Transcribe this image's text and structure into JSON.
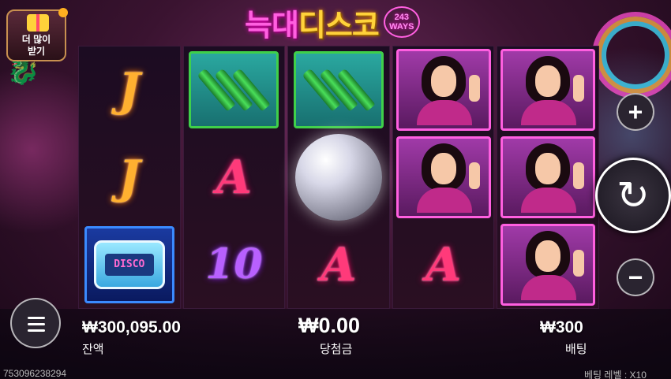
{
  "title": {
    "part1": "늑대",
    "part2": "디스코",
    "ways_number": "243",
    "ways_label": "WAYS"
  },
  "get_more": {
    "line1": "더 많이",
    "line2": "받기"
  },
  "reels": [
    [
      "J",
      "J",
      "pager"
    ],
    [
      "bottles",
      "A",
      "10"
    ],
    [
      "bottles",
      "disco-ball",
      "A"
    ],
    [
      "woman",
      "woman",
      "A"
    ],
    [
      "woman",
      "woman",
      "woman"
    ]
  ],
  "pager_text": "DISCO",
  "balance": {
    "value": "₩300,095.00",
    "label": "잔액"
  },
  "win": {
    "value": "₩0.00",
    "label": "당첨금"
  },
  "bet": {
    "value": "₩300",
    "label": "배팅"
  },
  "session_id": "753096238294",
  "bet_level": {
    "label": "베팅 레벨 :",
    "value": "X10"
  },
  "controls": {
    "plus": "+",
    "minus": "−",
    "spin": "↻"
  },
  "colors": {
    "accent_pink": "#ff5fe0",
    "accent_gold": "#ffd23a"
  }
}
